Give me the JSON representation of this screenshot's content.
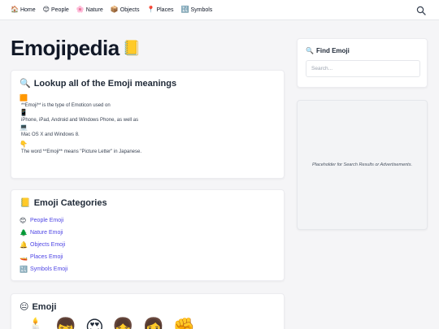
{
  "nav": {
    "items": [
      {
        "emoji": "🏠",
        "label": "Home"
      },
      {
        "emoji": "😊",
        "label": "People"
      },
      {
        "emoji": "🌸",
        "label": "Nature"
      },
      {
        "emoji": "📦",
        "label": "Objects"
      },
      {
        "emoji": "📍",
        "label": "Places"
      },
      {
        "emoji": "🔣",
        "label": "Symbols"
      }
    ]
  },
  "page": {
    "title": "Emojipedia",
    "title_emoji": "📒"
  },
  "lookup": {
    "emoji": "🔍",
    "heading": "Lookup all of the Emoji meanings",
    "lines": [
      {
        "emoji": "🟧",
        "text": "**Emoji** is the type of Emoticon used on"
      },
      {
        "emoji": "📱",
        "text": "iPhone, iPad, Android and Windows Phone, as well as"
      },
      {
        "emoji": "💻",
        "text": "Mac OS X and Windows 8."
      },
      {
        "emoji": "👇",
        "text": "The word **Emoji** means \"Picture Letter\" in Japanese."
      }
    ]
  },
  "categories": {
    "emoji": "📒",
    "heading": "Emoji Categories",
    "items": [
      {
        "emoji": "😊",
        "label": "People Emoji"
      },
      {
        "emoji": "🌲",
        "label": "Nature Emoji"
      },
      {
        "emoji": "🔔",
        "label": "Objects Emoji"
      },
      {
        "emoji": "🚤",
        "label": "Places Emoji"
      },
      {
        "emoji": "🔣",
        "label": "Symbols Emoji"
      }
    ]
  },
  "emoji_section": {
    "emoji": "😐",
    "heading": "Emoji",
    "samples": [
      "🕯️",
      "👦",
      "😍",
      "👧",
      "👩",
      "✊"
    ]
  },
  "find": {
    "emoji": "🔍",
    "heading": "Find Emoji",
    "placeholder": "Search..."
  },
  "sidebar": {
    "placeholder_text": "Placeholder for Search Results or Advertisements."
  },
  "icons": {
    "search": "search-icon"
  }
}
